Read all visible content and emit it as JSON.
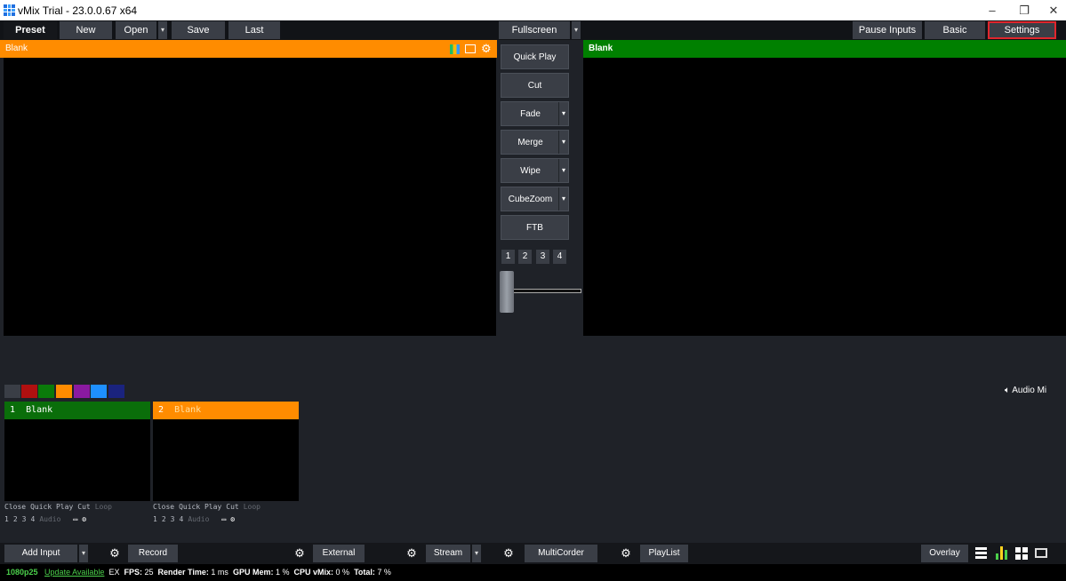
{
  "window": {
    "title": "vMix Trial - 23.0.0.67 x64",
    "min": "–",
    "max": "❐",
    "close": "✕"
  },
  "toolbar": {
    "preset": "Preset",
    "new": "New",
    "open": "Open",
    "save": "Save",
    "last": "Last",
    "fullscreen": "Fullscreen",
    "pause_inputs": "Pause Inputs",
    "basic": "Basic",
    "settings": "Settings"
  },
  "preview": {
    "title": "Blank"
  },
  "output": {
    "title": "Blank"
  },
  "transitions": {
    "quick_play": "Quick Play",
    "cut": "Cut",
    "fade": "Fade",
    "merge": "Merge",
    "wipe": "Wipe",
    "cubezoom": "CubeZoom",
    "ftb": "FTB",
    "numbers": [
      "1",
      "2",
      "3",
      "4"
    ]
  },
  "colors": {
    "preview_bar": "#ff8c00",
    "output_bar": "#008000",
    "accent": "#1e90ff"
  },
  "swatches": [
    "#3a3e46",
    "#b01010",
    "#0a7a0a",
    "#ff8c00",
    "#8a1aa0",
    "#1e90ff",
    "#1a237e"
  ],
  "audio_mixer": {
    "label": "Audio Mi",
    "icon": "speaker-icon"
  },
  "inputs": [
    {
      "number": "1",
      "name": "Blank",
      "color": "#0a6e0a",
      "controls": [
        "Close",
        "Quick Play",
        "Cut",
        "Loop"
      ],
      "nums": [
        "1",
        "2",
        "3",
        "4"
      ],
      "audio": "Audio"
    },
    {
      "number": "2",
      "name": "Blank",
      "color": "#ff8c00",
      "controls": [
        "Close",
        "Quick Play",
        "Cut",
        "Loop"
      ],
      "nums": [
        "1",
        "2",
        "3",
        "4"
      ],
      "audio": "Audio"
    }
  ],
  "bottom": {
    "add_input": "Add Input",
    "record": "Record",
    "external": "External",
    "stream": "Stream",
    "multicorder": "MultiCorder",
    "playlist": "PlayList",
    "overlay": "Overlay"
  },
  "status": {
    "format": "1080p25",
    "update": "Update Available",
    "ex": "EX",
    "fps_label": "FPS:",
    "fps": "25",
    "render_label": "Render Time:",
    "render": "1 ms",
    "gpu_label": "GPU Mem:",
    "gpu": "1 %",
    "cpu_label": "CPU vMix:",
    "cpu": "0 %",
    "total_label": "Total:",
    "total": "7 %"
  }
}
